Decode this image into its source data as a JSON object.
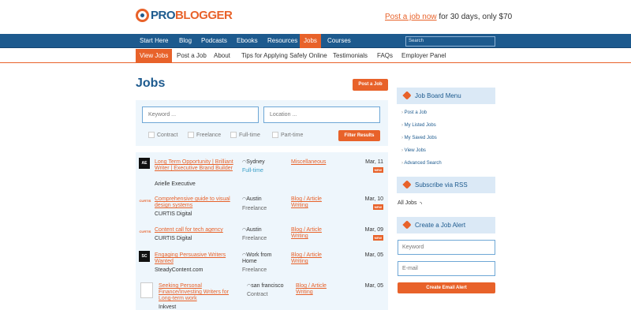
{
  "header": {
    "logo_pro": "PRO",
    "logo_blogger": "BLOGGER",
    "promo_link": "Post a job now",
    "promo_text": " for 30 days, only $70"
  },
  "main_nav": [
    "Start Here",
    "Blog",
    "Podcasts",
    "Ebooks",
    "Resources",
    "Jobs",
    "Courses"
  ],
  "search": {
    "placeholder": "Search"
  },
  "sub_nav": [
    "View Jobs",
    "Post a Job",
    "About",
    "Tips for Applying Safely Online",
    "Testimonials",
    "FAQs",
    "Employer Panel"
  ],
  "page": {
    "title": "Jobs",
    "post_button": "Post a Job"
  },
  "filters": {
    "keyword_placeholder": "Keyword ...",
    "location_placeholder": "Location ...",
    "contract": "Contract",
    "freelance": "Freelance",
    "fulltime": "Full-time",
    "parttime": "Part-time",
    "button": "Filter Results"
  },
  "jobs": [
    {
      "logo": "AE",
      "title": "Long Term Opportunity | Brilliant Writer | Executive Brand Builder",
      "company": "Arielle Executive",
      "location": "Sydney",
      "type": "Full-time",
      "category": "Miscellaneous",
      "date": "Mar, 11",
      "badge": "NEW"
    },
    {
      "logo": "CURTIS",
      "title": "Comprehensive guide to visual design systems",
      "company": "CURTIS Digital",
      "location": "Austin",
      "type": "Freelance",
      "category": "Blog / Article Writing",
      "date": "Mar, 10",
      "badge": "NEW"
    },
    {
      "logo": "CURTIS",
      "title": "Content call for tech agency",
      "company": "CURTIS Digital",
      "location": "Austin",
      "type": "Freelance",
      "category": "Blog / Article Writing",
      "date": "Mar, 09",
      "badge": "NEW"
    },
    {
      "logo": "SC",
      "title": "Engaging Persuasive Writers Wanted",
      "company": "SteadyContent.com",
      "location": "Work from Home",
      "type": "Freelance",
      "category": "Blog / Article Writing",
      "date": "Mar, 05",
      "badge": ""
    },
    {
      "logo": "",
      "title": "Seeking Personal Finance/Investing Writers for Long-term work",
      "company": "Inkvest",
      "location": "san francisco",
      "type": "Contract",
      "category": "Blog / Article Writing",
      "date": "Mar, 05",
      "badge": ""
    }
  ],
  "sidebar": {
    "menu_title": "Job Board Menu",
    "menu_links": [
      "Post a Job",
      "My Listed Jobs",
      "My Saved Jobs",
      "View Jobs",
      "Advanced Search"
    ],
    "rss_title": "Subscribe via RSS",
    "all_jobs": "All Jobs",
    "alert_title": "Create a Job Alert",
    "alert_keyword_placeholder": "Keyword",
    "alert_email_placeholder": "E-mail",
    "alert_button": "Create Email Alert"
  },
  "colors": {
    "brand_blue": "#1d5a8e",
    "accent_orange": "#e8622a"
  }
}
